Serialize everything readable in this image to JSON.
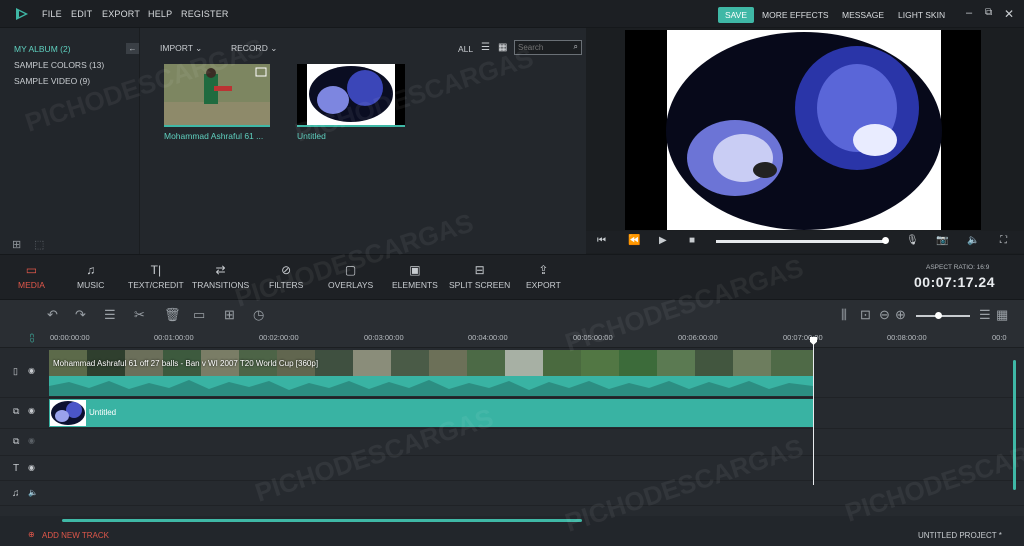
{
  "menubar": {
    "items": [
      "FILE",
      "EDIT",
      "EXPORT",
      "HELP",
      "REGISTER"
    ],
    "save": "SAVE",
    "right_items": [
      "MORE EFFECTS",
      "MESSAGE",
      "LIGHT SKIN"
    ]
  },
  "library": {
    "items": [
      "MY ALBUM (2)",
      "SAMPLE COLORS (13)",
      "SAMPLE VIDEO (9)"
    ]
  },
  "media": {
    "import": "IMPORT",
    "record": "RECORD",
    "filter_all": "ALL",
    "search_placeholder": "Search",
    "clips": [
      {
        "label": "Mohammad Ashraful 61 ..."
      },
      {
        "label": "Untitled"
      }
    ]
  },
  "tools": [
    "MEDIA",
    "MUSIC",
    "TEXT/CREDIT",
    "TRANSITIONS",
    "FILTERS",
    "OVERLAYS",
    "ELEMENTS",
    "SPLIT SCREEN",
    "EXPORT"
  ],
  "status": {
    "aspect": "ASPECT RATIO: 16:9",
    "timecode": "00:07:17.24"
  },
  "ruler": [
    "00:00:00:00",
    "00:01:00:00",
    "00:02:00:00",
    "00:03:00:00",
    "00:04:00:00",
    "00:05:00:00",
    "00:06:00:00",
    "00:07:00:00",
    "00:08:00:00",
    "00:0"
  ],
  "timeline": {
    "video_clip": "Mohammad Ashraful 61 off 27 balls - Ban v WI 2007 T20 World Cup [360p]",
    "pip_clip": "Untitled",
    "progress": 0.74
  },
  "bottom": {
    "add_track": "ADD NEW TRACK",
    "project": "UNTITLED PROJECT *"
  },
  "watermark": "PICHODESCARGAS",
  "colors": {
    "accent": "#3fb8a6",
    "active_tool": "#e0574a"
  }
}
